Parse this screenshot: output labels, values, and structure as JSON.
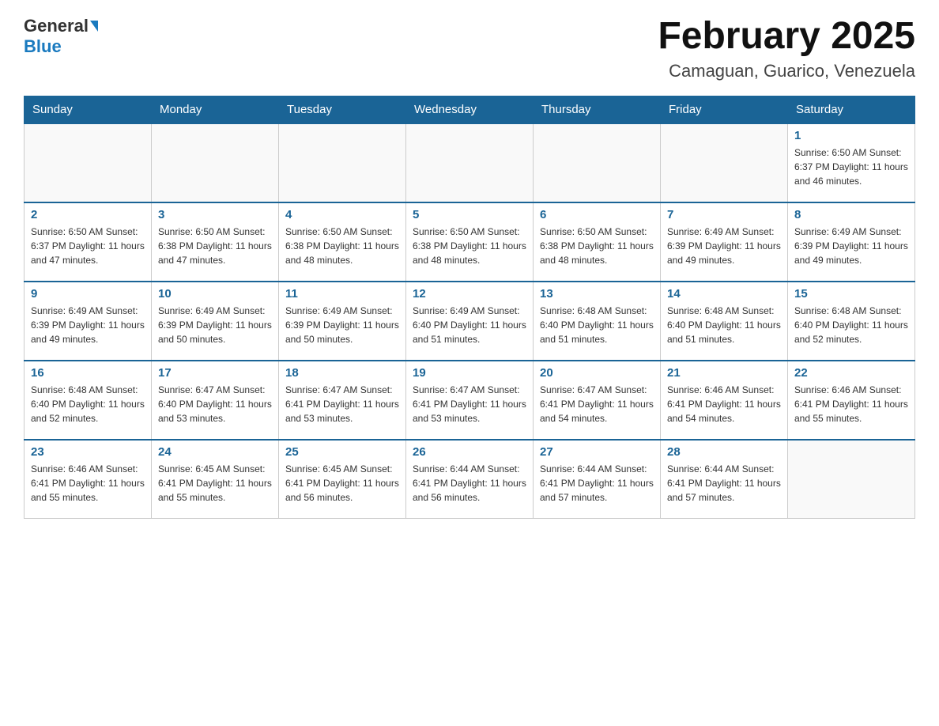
{
  "header": {
    "logo_general": "General",
    "logo_blue": "Blue",
    "month_title": "February 2025",
    "location": "Camaguan, Guarico, Venezuela"
  },
  "days_of_week": [
    "Sunday",
    "Monday",
    "Tuesday",
    "Wednesday",
    "Thursday",
    "Friday",
    "Saturday"
  ],
  "weeks": [
    [
      {
        "day": "",
        "info": ""
      },
      {
        "day": "",
        "info": ""
      },
      {
        "day": "",
        "info": ""
      },
      {
        "day": "",
        "info": ""
      },
      {
        "day": "",
        "info": ""
      },
      {
        "day": "",
        "info": ""
      },
      {
        "day": "1",
        "info": "Sunrise: 6:50 AM\nSunset: 6:37 PM\nDaylight: 11 hours and 46 minutes."
      }
    ],
    [
      {
        "day": "2",
        "info": "Sunrise: 6:50 AM\nSunset: 6:37 PM\nDaylight: 11 hours and 47 minutes."
      },
      {
        "day": "3",
        "info": "Sunrise: 6:50 AM\nSunset: 6:38 PM\nDaylight: 11 hours and 47 minutes."
      },
      {
        "day": "4",
        "info": "Sunrise: 6:50 AM\nSunset: 6:38 PM\nDaylight: 11 hours and 48 minutes."
      },
      {
        "day": "5",
        "info": "Sunrise: 6:50 AM\nSunset: 6:38 PM\nDaylight: 11 hours and 48 minutes."
      },
      {
        "day": "6",
        "info": "Sunrise: 6:50 AM\nSunset: 6:38 PM\nDaylight: 11 hours and 48 minutes."
      },
      {
        "day": "7",
        "info": "Sunrise: 6:49 AM\nSunset: 6:39 PM\nDaylight: 11 hours and 49 minutes."
      },
      {
        "day": "8",
        "info": "Sunrise: 6:49 AM\nSunset: 6:39 PM\nDaylight: 11 hours and 49 minutes."
      }
    ],
    [
      {
        "day": "9",
        "info": "Sunrise: 6:49 AM\nSunset: 6:39 PM\nDaylight: 11 hours and 49 minutes."
      },
      {
        "day": "10",
        "info": "Sunrise: 6:49 AM\nSunset: 6:39 PM\nDaylight: 11 hours and 50 minutes."
      },
      {
        "day": "11",
        "info": "Sunrise: 6:49 AM\nSunset: 6:39 PM\nDaylight: 11 hours and 50 minutes."
      },
      {
        "day": "12",
        "info": "Sunrise: 6:49 AM\nSunset: 6:40 PM\nDaylight: 11 hours and 51 minutes."
      },
      {
        "day": "13",
        "info": "Sunrise: 6:48 AM\nSunset: 6:40 PM\nDaylight: 11 hours and 51 minutes."
      },
      {
        "day": "14",
        "info": "Sunrise: 6:48 AM\nSunset: 6:40 PM\nDaylight: 11 hours and 51 minutes."
      },
      {
        "day": "15",
        "info": "Sunrise: 6:48 AM\nSunset: 6:40 PM\nDaylight: 11 hours and 52 minutes."
      }
    ],
    [
      {
        "day": "16",
        "info": "Sunrise: 6:48 AM\nSunset: 6:40 PM\nDaylight: 11 hours and 52 minutes."
      },
      {
        "day": "17",
        "info": "Sunrise: 6:47 AM\nSunset: 6:40 PM\nDaylight: 11 hours and 53 minutes."
      },
      {
        "day": "18",
        "info": "Sunrise: 6:47 AM\nSunset: 6:41 PM\nDaylight: 11 hours and 53 minutes."
      },
      {
        "day": "19",
        "info": "Sunrise: 6:47 AM\nSunset: 6:41 PM\nDaylight: 11 hours and 53 minutes."
      },
      {
        "day": "20",
        "info": "Sunrise: 6:47 AM\nSunset: 6:41 PM\nDaylight: 11 hours and 54 minutes."
      },
      {
        "day": "21",
        "info": "Sunrise: 6:46 AM\nSunset: 6:41 PM\nDaylight: 11 hours and 54 minutes."
      },
      {
        "day": "22",
        "info": "Sunrise: 6:46 AM\nSunset: 6:41 PM\nDaylight: 11 hours and 55 minutes."
      }
    ],
    [
      {
        "day": "23",
        "info": "Sunrise: 6:46 AM\nSunset: 6:41 PM\nDaylight: 11 hours and 55 minutes."
      },
      {
        "day": "24",
        "info": "Sunrise: 6:45 AM\nSunset: 6:41 PM\nDaylight: 11 hours and 55 minutes."
      },
      {
        "day": "25",
        "info": "Sunrise: 6:45 AM\nSunset: 6:41 PM\nDaylight: 11 hours and 56 minutes."
      },
      {
        "day": "26",
        "info": "Sunrise: 6:44 AM\nSunset: 6:41 PM\nDaylight: 11 hours and 56 minutes."
      },
      {
        "day": "27",
        "info": "Sunrise: 6:44 AM\nSunset: 6:41 PM\nDaylight: 11 hours and 57 minutes."
      },
      {
        "day": "28",
        "info": "Sunrise: 6:44 AM\nSunset: 6:41 PM\nDaylight: 11 hours and 57 minutes."
      },
      {
        "day": "",
        "info": ""
      }
    ]
  ]
}
